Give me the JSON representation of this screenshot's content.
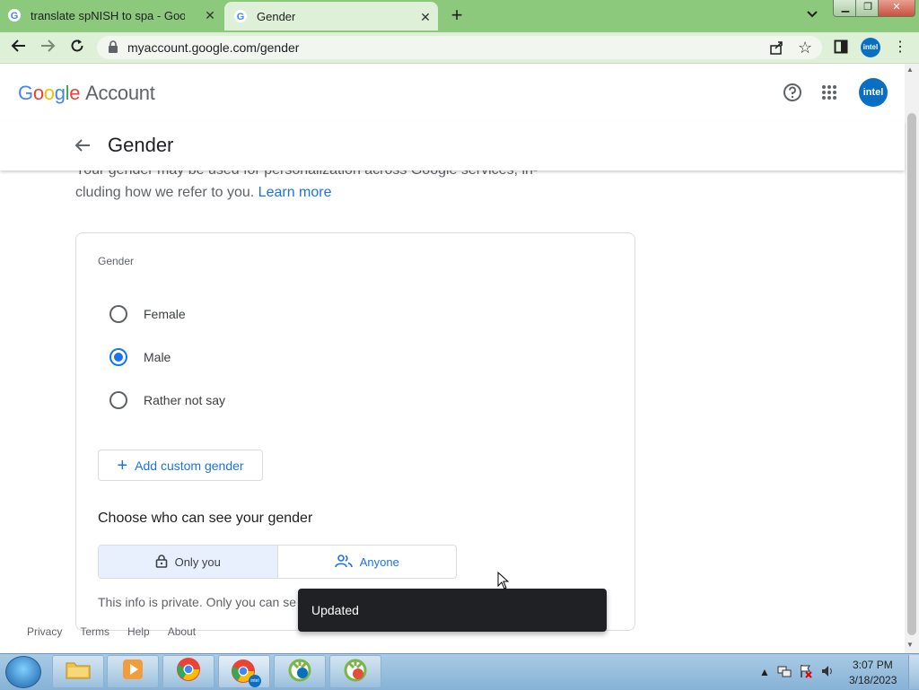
{
  "browser": {
    "tabs": [
      {
        "title": "translate spNISH to spa - Google"
      },
      {
        "title": "Gender"
      }
    ],
    "new_tab_symbol": "+",
    "url": "myaccount.google.com/gender",
    "profile_label": "intel"
  },
  "header": {
    "logo_letters": [
      "G",
      "o",
      "o",
      "g",
      "l",
      "e"
    ],
    "logo_colors": [
      "#4285f4",
      "#ea4335",
      "#fbbc05",
      "#4285f4",
      "#34a853",
      "#ea4335"
    ],
    "account_label": "Account",
    "avatar_label": "intel"
  },
  "page": {
    "title": "Gender",
    "description_line1": "Your gender may be used for personalization across Google services, in-",
    "description_line2": "cluding how we refer to you.",
    "learn_more": "Learn more"
  },
  "gender_card": {
    "label": "Gender",
    "options": [
      {
        "label": "Female",
        "selected": false
      },
      {
        "label": "Male",
        "selected": true
      },
      {
        "label": "Rather not say",
        "selected": false
      }
    ],
    "add_custom_label": "Add custom gender",
    "visibility_heading": "Choose who can see your gender",
    "visibility_options": [
      {
        "label": "Only you",
        "selected": true,
        "icon": "lock-icon"
      },
      {
        "label": "Anyone",
        "selected": false,
        "icon": "people-icon"
      }
    ],
    "privacy_info": "This info is private. Only you can se"
  },
  "footer": {
    "links": [
      "Privacy",
      "Terms",
      "Help",
      "About"
    ]
  },
  "snackbar": {
    "message": "Updated"
  },
  "taskbar": {
    "time": "3:07 PM",
    "date": "3/18/2023",
    "profile_badge": "intel"
  },
  "colors": {
    "accent": "#1a73e8",
    "tab_strip": "#8cc97c",
    "toolbar": "#dff0d8",
    "snackbar": "#202124"
  }
}
